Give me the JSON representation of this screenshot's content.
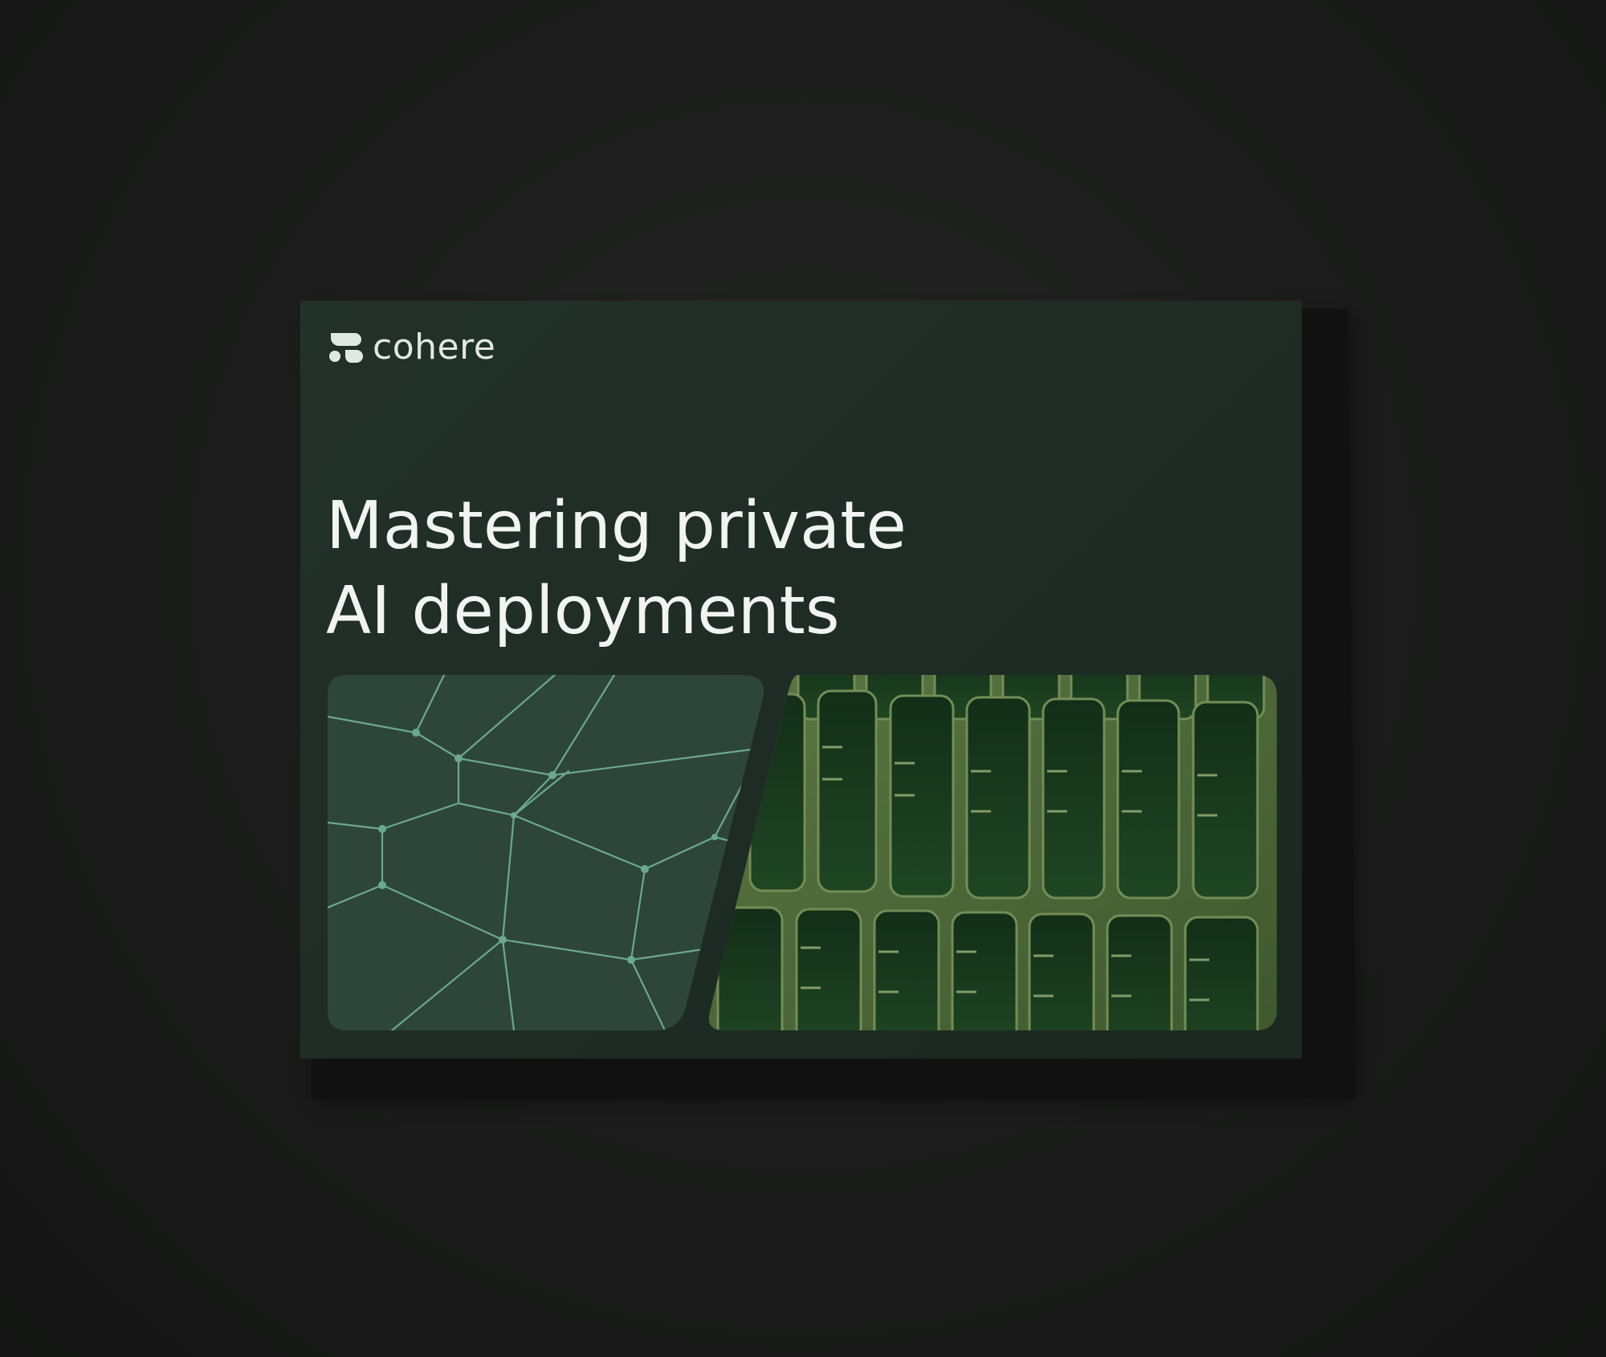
{
  "brand": {
    "name": "cohere"
  },
  "cover": {
    "title_line_1": "Mastering private",
    "title_line_2": "AI deployments"
  },
  "icons": {
    "logo": "cohere-logo-icon",
    "pattern": "cell-network-pattern",
    "photo": "building-facade-photo"
  },
  "colors": {
    "background": "#1c1d1c",
    "cover": "#1f2c25",
    "pattern_fill": "#2e453b",
    "pattern_lines": "#6aa893",
    "photo_tint": "#4f6b3a",
    "text": "#f1f4f1"
  }
}
